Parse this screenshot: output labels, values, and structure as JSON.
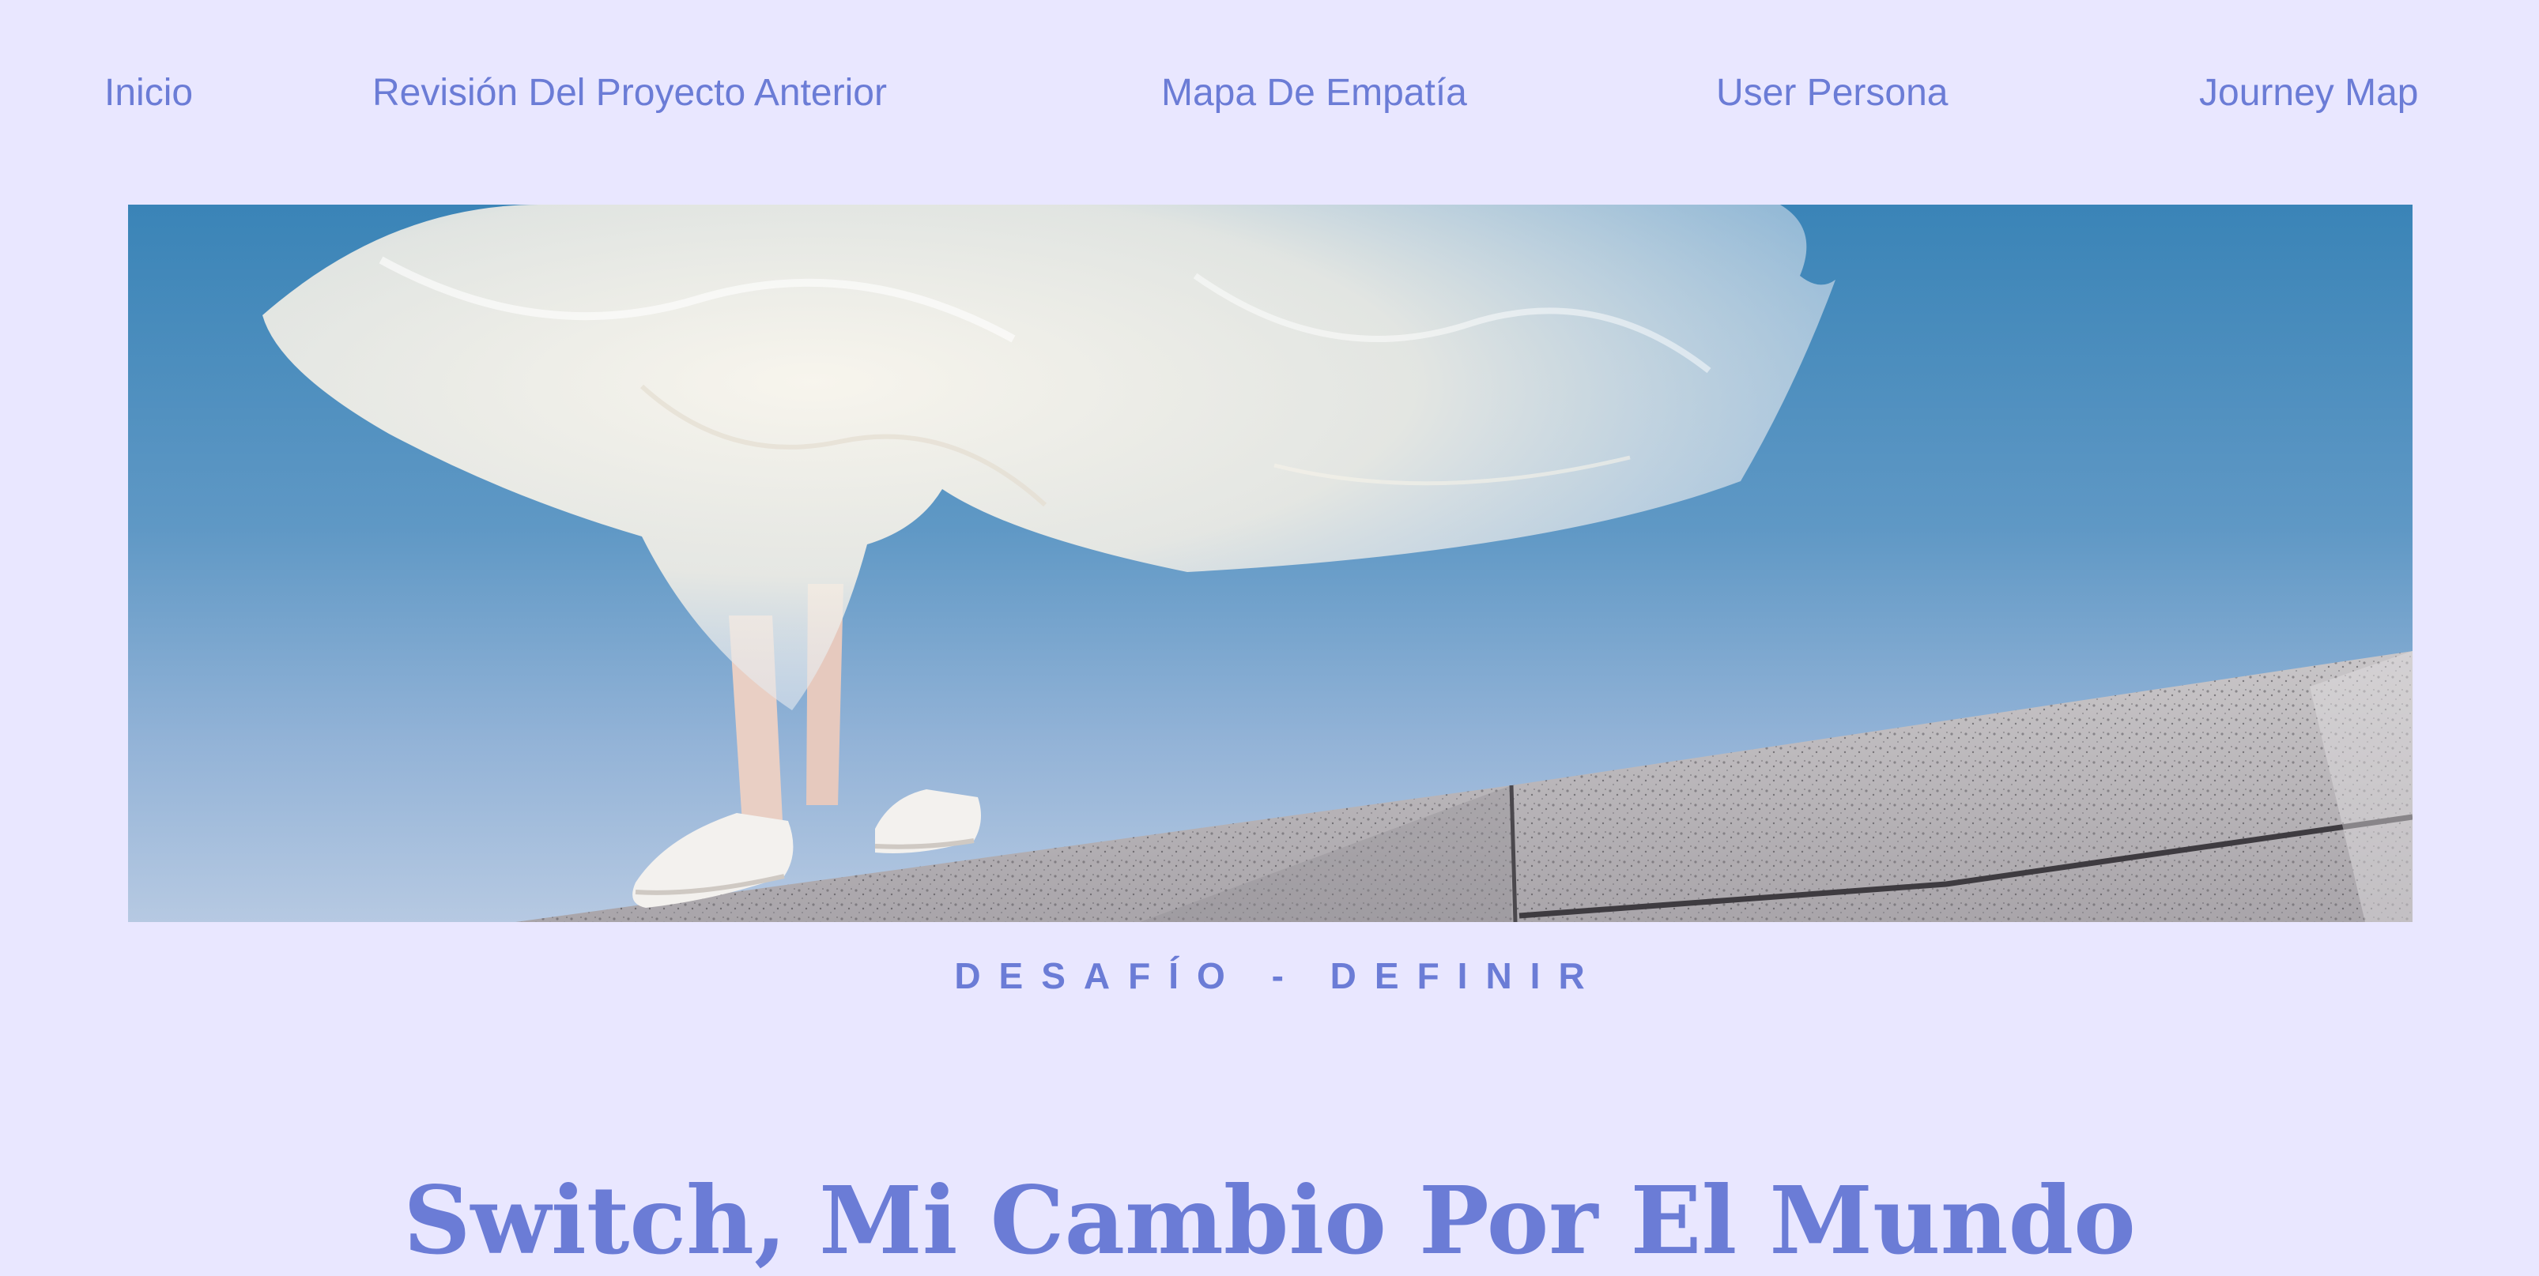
{
  "nav": {
    "items": [
      {
        "label": "Inicio"
      },
      {
        "label": "Revisión Del Proyecto Anterior"
      },
      {
        "label": "Mapa De Empatía"
      },
      {
        "label": "User Persona"
      },
      {
        "label": "Journey Map"
      }
    ]
  },
  "hero": {
    "eyebrow": "DESAFÍO - DEFINIR",
    "title": "Switch, Mi Cambio Por El Mundo"
  },
  "colors": {
    "background": "#e9e7ff",
    "accent": "#6b7cd6",
    "sky_top": "#3e86b8",
    "sky_bottom": "#b2c7e1"
  }
}
